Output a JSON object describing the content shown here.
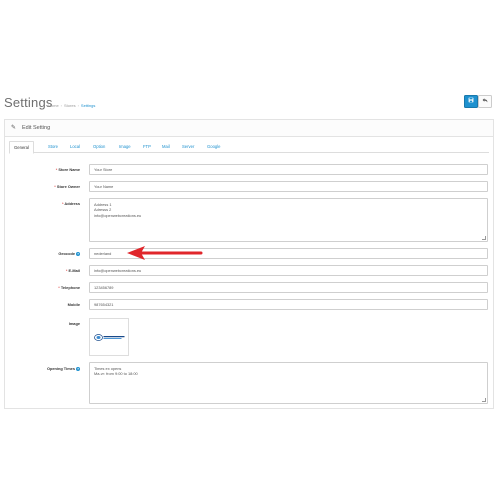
{
  "header": {
    "title": "Settings",
    "breadcrumb": [
      "Home",
      "Stores",
      "Settings"
    ],
    "save_icon": "save-icon",
    "back_icon": "reply-icon",
    "accent": "#1e91cf"
  },
  "panel": {
    "title": "Edit Setting",
    "icon": "pencil-icon"
  },
  "tabs": [
    {
      "label": "General",
      "active": true
    },
    {
      "label": "Store"
    },
    {
      "label": "Local"
    },
    {
      "label": "Option"
    },
    {
      "label": "Image"
    },
    {
      "label": "FTP"
    },
    {
      "label": "Mail"
    },
    {
      "label": "Server"
    },
    {
      "label": "Google"
    }
  ],
  "form": {
    "store_name": {
      "label": "Store Name",
      "value": "Your Store",
      "required": true
    },
    "store_owner": {
      "label": "Store Owner",
      "value": "Your Name",
      "required": true
    },
    "address": {
      "label": "Address",
      "lines": [
        "Address 1",
        "Adresss 2",
        "info@openwebcreations.eu"
      ],
      "required": true
    },
    "geocode": {
      "label": "Geocode",
      "value": "nederland"
    },
    "email": {
      "label": "E-Mail",
      "value": "info@openwebcreations.eu",
      "required": true
    },
    "telephone": {
      "label": "Telephone",
      "value": "123456789",
      "required": true
    },
    "mobile": {
      "label": "Mobile",
      "value": "987654321"
    },
    "image": {
      "label": "Image",
      "logo": "openwebcreations-logo"
    },
    "opening_times": {
      "label": "Opening Times",
      "lines": [
        "Times ex opens",
        "Ma-vr: from 9:00 to 18:00"
      ],
      "required": false
    }
  },
  "annotation": {
    "arrow_color": "#e0262b"
  }
}
